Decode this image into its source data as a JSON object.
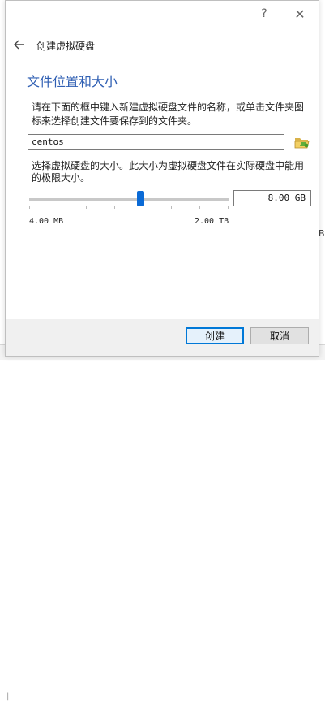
{
  "dialog": {
    "help_label": "?",
    "close_label": "✕",
    "back_label": "←",
    "wizard_title": "创建虚拟硬盘",
    "section_title": "文件位置和大小",
    "location_description": "请在下面的框中键入新建虚拟硬盘文件的名称，或单击文件夹图标来选择创建文件要保存到的文件夹。",
    "file_name_value": "centos",
    "size_description": "选择虚拟硬盘的大小。此大小为虚拟硬盘文件在实际硬盘中能用的极限大小。",
    "size_value": "8.00 GB",
    "size_min_label": "4.00 MB",
    "size_max_label": "2.00 TB",
    "slider_fraction": 0.56
  },
  "buttons": {
    "create_label": "创建",
    "cancel_label": "取消"
  },
  "background": {
    "right_edge_text": "B]",
    "bottom_text": "|"
  },
  "icons": {
    "folder": "folder-open-icon",
    "back": "back-arrow-icon"
  },
  "colors": {
    "accent": "#2f5fb3",
    "slider_thumb": "#0a6ad6",
    "default_button_border": "#0078d7"
  }
}
